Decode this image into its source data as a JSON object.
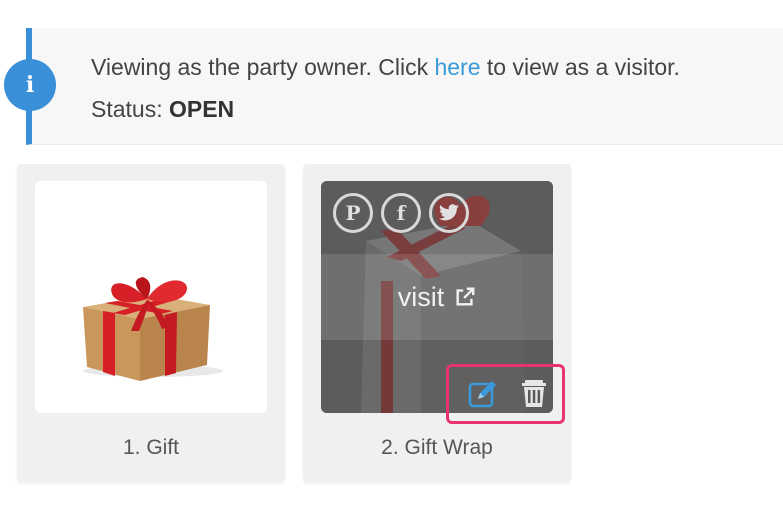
{
  "notice": {
    "icon": "info-icon",
    "text_before": "Viewing as the party owner. Click ",
    "link_text": "here",
    "text_after": " to view as a visitor.",
    "status_label": "Status: ",
    "status_value": "OPEN",
    "accent_color": "#3a8fd9"
  },
  "cards": [
    {
      "caption": "1. Gift",
      "image": "gift-box-red-ribbon"
    },
    {
      "caption": "2. Gift Wrap",
      "image": "wrapped-gift-dimmed",
      "visit_label": "visit",
      "social_icons": [
        "pinterest-icon",
        "facebook-icon",
        "twitter-icon"
      ],
      "actions": [
        "edit-icon",
        "trash-icon"
      ],
      "highlight_color": "#e8336e"
    }
  ]
}
